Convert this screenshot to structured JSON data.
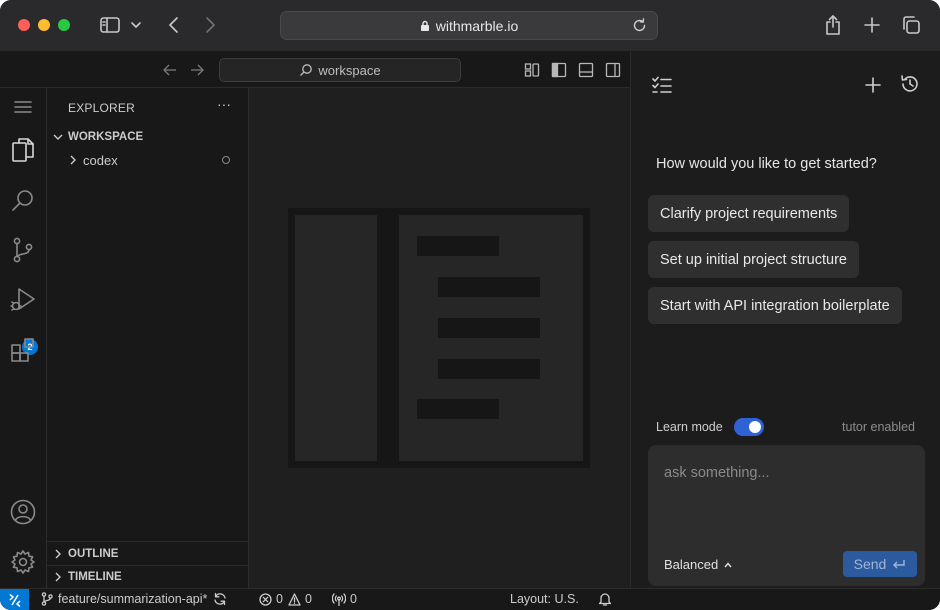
{
  "browser": {
    "url": "withmarble.io",
    "traffic_lights": {
      "close": "#ff5f57",
      "minimize": "#febc2e",
      "zoom": "#28c840"
    }
  },
  "titlebar": {
    "command_center": "workspace"
  },
  "activity_bar": {
    "icons": [
      "menu-icon",
      "explorer-icon",
      "search-icon",
      "source-control-icon",
      "run-debug-icon",
      "extensions-icon",
      "account-icon",
      "settings-gear-icon"
    ],
    "source_control_badge": "2",
    "badge_color": "#0078d4"
  },
  "sidebar": {
    "title": "EXPLORER",
    "more": "···",
    "workspace_header": "WORKSPACE",
    "items": [
      {
        "label": "codex"
      }
    ],
    "outline_header": "OUTLINE",
    "timeline_header": "TIMELINE"
  },
  "chat": {
    "prompt": "How would you like to get started?",
    "suggestions": [
      "Clarify project requirements",
      "Set up initial project structure",
      "Start with API integration boilerplate"
    ],
    "learn_mode_label": "Learn mode",
    "learn_mode_on": true,
    "tutor_status": "tutor enabled",
    "input_placeholder": "ask something...",
    "mode_label": "Balanced",
    "send_label": "Send",
    "accent": "#2f62d6"
  },
  "statusbar": {
    "branch": "feature/summarization-api*",
    "errors": "0",
    "warnings": "0",
    "ports": "0",
    "layout": "Layout: U.S.",
    "remote_color": "#0078d4"
  }
}
